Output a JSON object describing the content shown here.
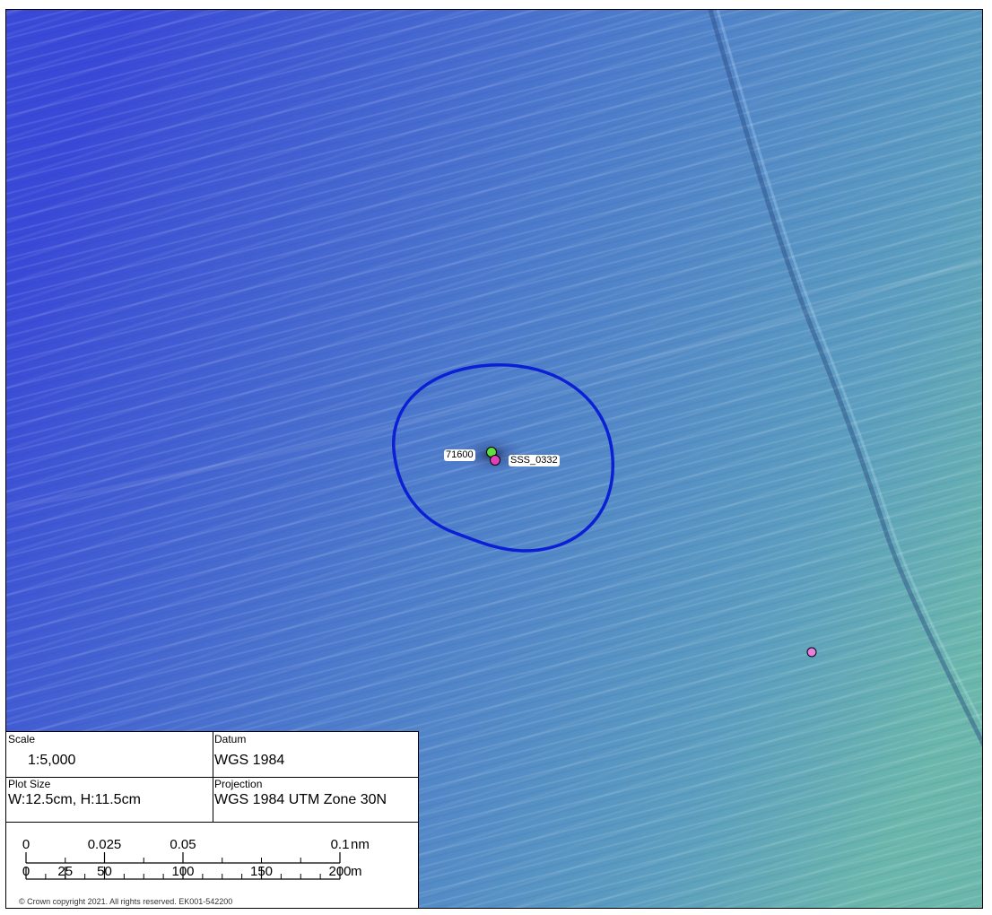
{
  "map": {
    "background_colors": {
      "deep": "#3a4fd6",
      "mid": "#4f86c8",
      "shallow": "#6ab2ae"
    },
    "buffer_color": "#0b1fd6",
    "labels": {
      "contact": "71600",
      "sss": "SSS_0332"
    },
    "points": [
      {
        "name": "contact-71600",
        "color": "#5fe040"
      },
      {
        "name": "sss-0332",
        "color": "#e040b8"
      },
      {
        "name": "isolated-target",
        "color": "#e880e0"
      }
    ]
  },
  "legend": {
    "scale_title": "Scale",
    "scale_value": "1:5,000",
    "datum_title": "Datum",
    "datum_value": "WGS 1984",
    "plotsize_title": "Plot Size",
    "plotsize_value": "W:12.5cm, H:11.5cm",
    "projection_title": "Projection",
    "projection_value": "WGS 1984 UTM Zone 30N",
    "scalebar_nm": [
      "0",
      "0.025",
      "0.05",
      "0.1"
    ],
    "scalebar_nm_unit": "nm",
    "scalebar_m": [
      "0",
      "25",
      "50",
      "100",
      "150",
      "200"
    ],
    "scalebar_m_unit": "m",
    "copyright": "© Crown copyright 2021. All rights reserved. EK001-542200"
  }
}
